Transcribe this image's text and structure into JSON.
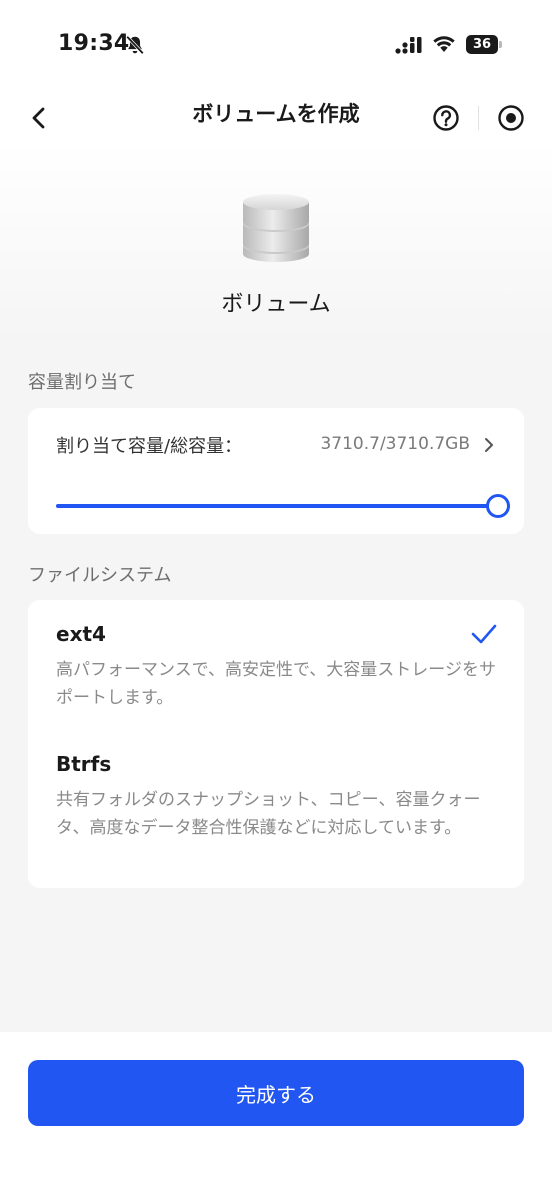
{
  "status_bar": {
    "time": "19:34",
    "battery_level": "36",
    "battery_fraction": 0.36
  },
  "nav": {
    "title": "ボリュームを作成",
    "icons": [
      "back-icon",
      "help-icon",
      "record-icon"
    ]
  },
  "header": {
    "icon": "database-icon",
    "title": "ボリューム"
  },
  "allocation": {
    "section_label": "容量割り当て",
    "label": "割り当て容量/総容量：",
    "value": "3710.7/3710.7GB",
    "slider_fraction": 1.0
  },
  "filesystem": {
    "section_label": "ファイルシステム",
    "options": [
      {
        "name": "ext4",
        "description": "高パフォーマンスで、高安定性で、大容量ストレージをサポートします。",
        "selected": true
      },
      {
        "name": "Btrfs",
        "description": "共有フォルダのスナップショット、コピー、容量クォータ、高度なデータ整合性保護などに対応しています。",
        "selected": false
      }
    ]
  },
  "footer": {
    "done_label": "完成する"
  },
  "colors": {
    "accent": "#2156f3",
    "background": "#f5f5f5",
    "card": "#ffffff",
    "muted_text": "#8a8a8a"
  }
}
